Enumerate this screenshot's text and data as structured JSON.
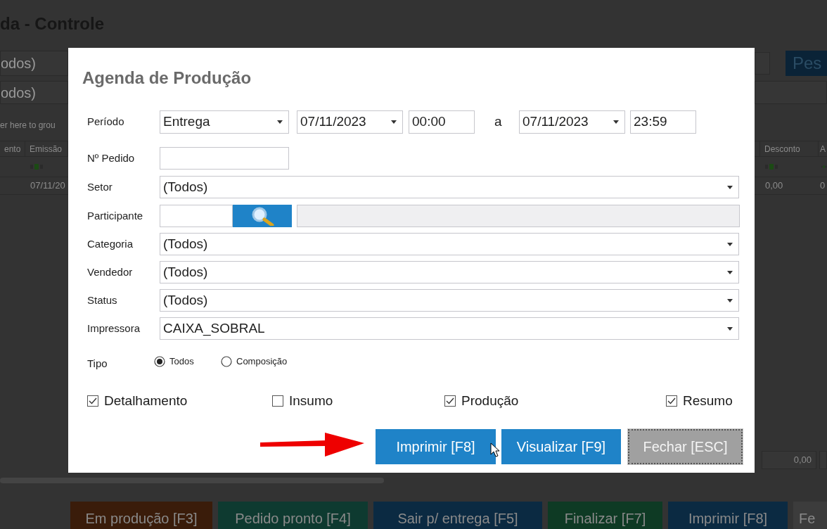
{
  "app": {
    "title": "da - Controle",
    "filter_rows": [
      {
        "value": "odos)"
      },
      {
        "value": "odos)"
      }
    ],
    "search_button": "Pes",
    "group_panel_hint": "er here to grou",
    "grid": {
      "left_columns": [
        "ento",
        "Emissão"
      ],
      "right_columns": [
        "Desconto",
        "A"
      ],
      "left_row": [
        "07/11/20"
      ],
      "right_row": [
        "0,00",
        "0"
      ]
    },
    "footer_total": "0,00",
    "actions": [
      {
        "label": "Em produção [F3]",
        "color": "#3a1c0a"
      },
      {
        "label": "Pedido pronto [F4]",
        "color": "#0e3a30"
      },
      {
        "label": "Sair p/ entrega [F5]",
        "color": "#0b2a42"
      },
      {
        "label": "Finalizar [F7]",
        "color": "#0e3a24"
      },
      {
        "label": "Imprimir [F8]",
        "color": "#0b2a42"
      },
      {
        "label": "Fe",
        "color": "#3c3c3c"
      }
    ]
  },
  "dialog": {
    "title": "Agenda de Produção",
    "period": {
      "label": "Período",
      "type": "Entrega",
      "start_date": "07/11/2023",
      "start_time": "00:00",
      "separator": "a",
      "end_date": "07/11/2023",
      "end_time": "23:59"
    },
    "fields": [
      {
        "kind": "text",
        "label": "Nº Pedido"
      },
      {
        "kind": "select",
        "label": "Setor",
        "value": "(Todos)"
      },
      {
        "kind": "lookup",
        "label": "Participante"
      },
      {
        "kind": "select",
        "label": "Categoria",
        "value": "(Todos)"
      },
      {
        "kind": "select",
        "label": "Vendedor",
        "value": "(Todos)"
      },
      {
        "kind": "select",
        "label": "Status",
        "value": "(Todos)"
      },
      {
        "kind": "select",
        "label": "Impressora",
        "value": "CAIXA_SOBRAL"
      }
    ],
    "tipo": {
      "label": "Tipo",
      "options": [
        {
          "label": "Todos",
          "selected": true
        },
        {
          "label": "Composição",
          "selected": false
        }
      ]
    },
    "checkboxes": [
      {
        "label": "Detalhamento",
        "checked": true
      },
      {
        "label": "Insumo",
        "checked": false
      },
      {
        "label": "Produção",
        "checked": true
      },
      {
        "label": "Resumo",
        "checked": true
      }
    ],
    "buttons": [
      {
        "label": "Imprimir [F8]",
        "kind": "primary"
      },
      {
        "label": "Visualizar [F9]",
        "kind": "primary"
      },
      {
        "label": "Fechar [ESC]",
        "kind": "cancel"
      }
    ]
  }
}
